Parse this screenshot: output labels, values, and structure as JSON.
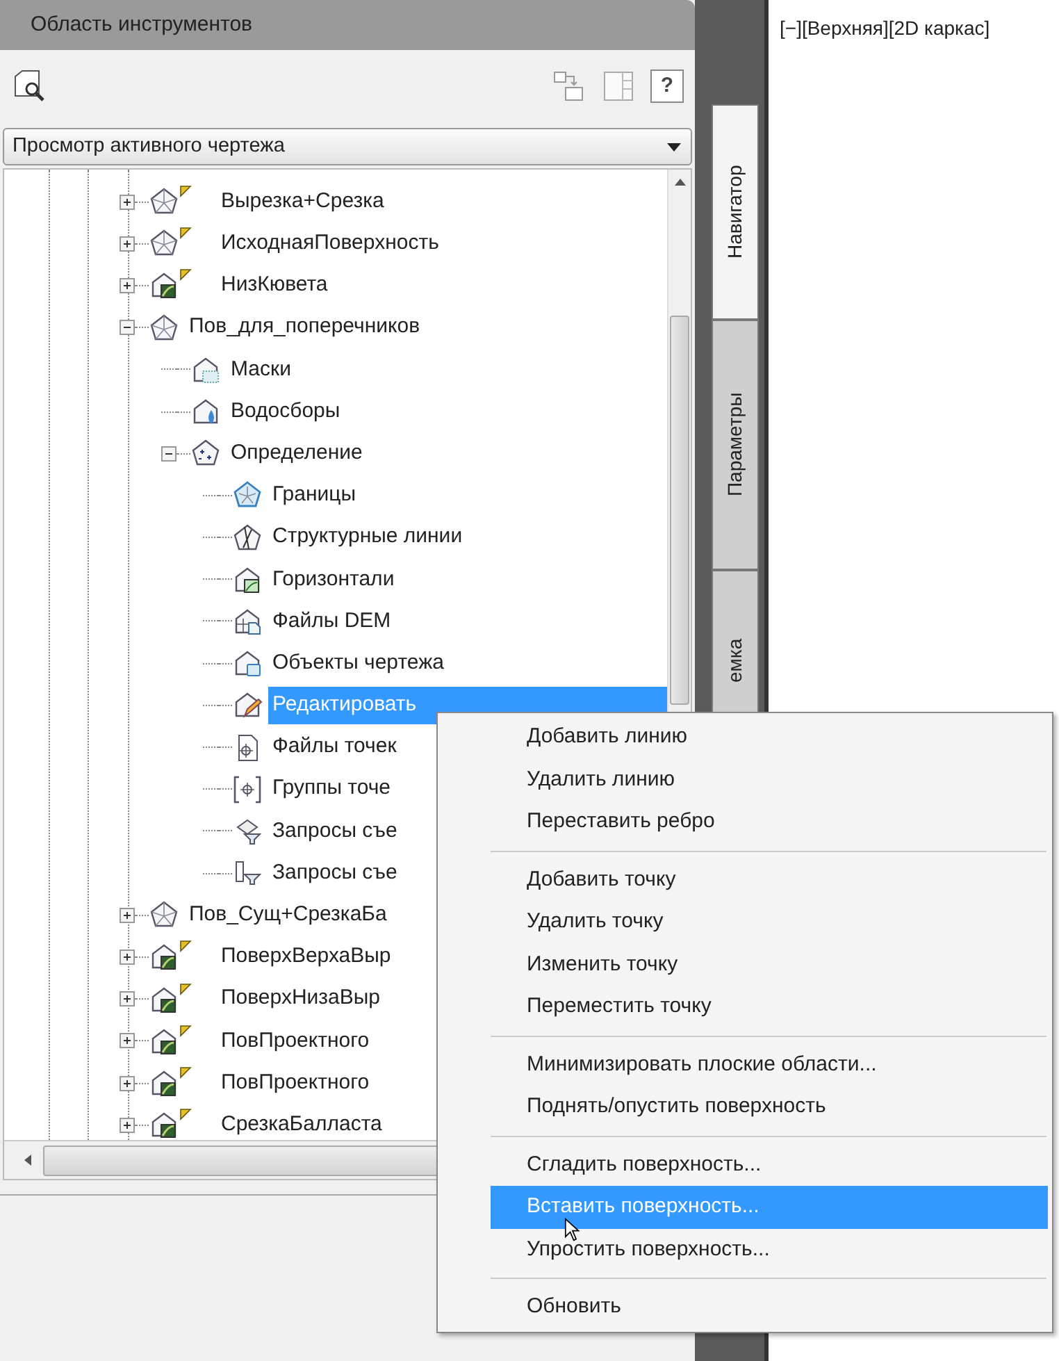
{
  "panel": {
    "title": "Область инструментов",
    "help_button": "?",
    "view_dropdown": {
      "value": "Просмотр активного чертежа"
    },
    "tree": [
      {
        "label": "Вырезка+Срезка",
        "kind": "surface",
        "flagged": true,
        "expanded": false,
        "selected": false
      },
      {
        "label": "ИсходнаяПоверхность",
        "kind": "surface",
        "flagged": true,
        "expanded": false,
        "selected": false
      },
      {
        "label": "НизКювета",
        "kind": "tin",
        "flagged": true,
        "expanded": false,
        "selected": false
      },
      {
        "label": "Пов_для_поперечников",
        "kind": "surface",
        "flagged": false,
        "expanded": true,
        "selected": false,
        "children": [
          {
            "label": "Маски",
            "kind": "masks",
            "flagged": false,
            "selected": false
          },
          {
            "label": "Водосборы",
            "kind": "watersheds",
            "flagged": false,
            "selected": false
          },
          {
            "label": "Определение",
            "kind": "definition",
            "flagged": false,
            "expanded": true,
            "selected": false,
            "children": [
              {
                "label": "Границы",
                "kind": "boundaries",
                "flagged": false,
                "selected": false
              },
              {
                "label": "Структурные линии",
                "kind": "breaklines",
                "flagged": false,
                "selected": false
              },
              {
                "label": "Горизонтали",
                "kind": "contours",
                "flagged": false,
                "selected": false
              },
              {
                "label": "Файлы DEM",
                "kind": "dem",
                "flagged": false,
                "selected": false
              },
              {
                "label": "Объекты чертежа",
                "kind": "objects",
                "flagged": false,
                "selected": false
              },
              {
                "label": "Редактировать",
                "kind": "edits",
                "flagged": false,
                "selected": true
              },
              {
                "label": "Файлы точек",
                "kind": "pointfiles",
                "flagged": false,
                "selected": false
              },
              {
                "label": "Группы точе",
                "kind": "pointgroups",
                "flagged": false,
                "selected": false
              },
              {
                "label": "Запросы съе",
                "kind": "queries",
                "flagged": false,
                "selected": false
              },
              {
                "label": "Запросы съе",
                "kind": "figurequeries",
                "flagged": false,
                "selected": false
              }
            ]
          }
        ]
      },
      {
        "label": "Пов_Сущ+СрезкаБа",
        "kind": "surface",
        "flagged": false,
        "expanded": false,
        "selected": false
      },
      {
        "label": "ПоверхВерхаВыр",
        "kind": "tin",
        "flagged": true,
        "expanded": false,
        "selected": false
      },
      {
        "label": "ПоверхНизаВыр",
        "kind": "tin",
        "flagged": true,
        "expanded": false,
        "selected": false
      },
      {
        "label": "ПовПроектного",
        "kind": "tin",
        "flagged": true,
        "expanded": false,
        "selected": false
      },
      {
        "label": "ПовПроектного",
        "kind": "tin",
        "flagged": true,
        "expanded": false,
        "selected": false
      },
      {
        "label": "СрезкаБалласта",
        "kind": "tin",
        "flagged": true,
        "expanded": false,
        "selected": false
      }
    ],
    "tabs": [
      {
        "label": "Навигатор",
        "selected": true
      },
      {
        "label": "Параметры",
        "selected": false
      },
      {
        "label": "емка",
        "selected": false
      }
    ]
  },
  "viewport": {
    "label": "[−][Верхняя][2D каркас]"
  },
  "context_menu": {
    "groups": [
      [
        {
          "label": "Добавить линию",
          "selected": false
        },
        {
          "label": "Удалить линию",
          "selected": false
        },
        {
          "label": "Переставить ребро",
          "selected": false
        }
      ],
      [
        {
          "label": "Добавить точку",
          "selected": false
        },
        {
          "label": "Удалить точку",
          "selected": false
        },
        {
          "label": "Изменить точку",
          "selected": false
        },
        {
          "label": "Переместить точку",
          "selected": false
        }
      ],
      [
        {
          "label": "Минимизировать плоские области...",
          "selected": false
        },
        {
          "label": "Поднять/опустить поверхность",
          "selected": false
        }
      ],
      [
        {
          "label": "Сгладить поверхность...",
          "selected": false
        },
        {
          "label": "Вставить поверхность...",
          "selected": true
        },
        {
          "label": "Упростить поверхность...",
          "selected": false
        }
      ],
      [
        {
          "label": "Обновить",
          "selected": false
        }
      ]
    ]
  }
}
